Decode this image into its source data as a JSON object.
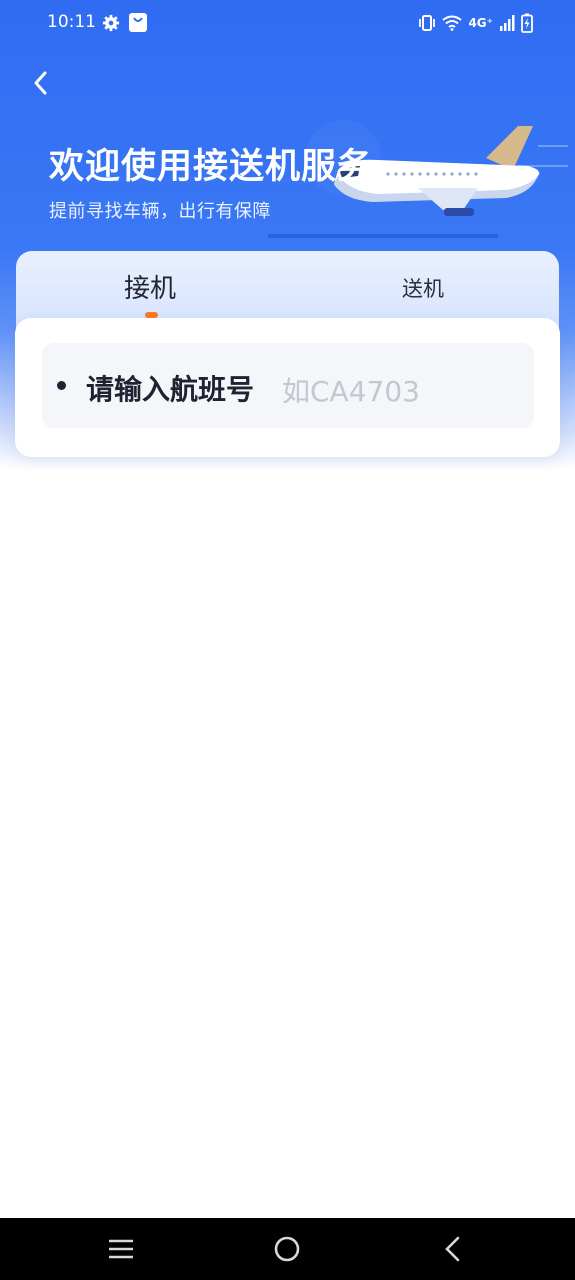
{
  "status_bar": {
    "time": "10:11",
    "network": "4G⁺",
    "icons": [
      "gear-icon",
      "shopping-bag-icon",
      "vibrate-icon",
      "wifi-icon",
      "signal-icon",
      "battery-charging-icon"
    ]
  },
  "header": {
    "back_icon": "chevron-left-icon",
    "title": "欢迎使用接送机服务",
    "subtitle": "提前寻找车辆，出行有保障",
    "illustration": "airplane-illustration"
  },
  "tabs": [
    {
      "label": "接机",
      "active": true
    },
    {
      "label": "送机",
      "active": false
    }
  ],
  "flight_input": {
    "label": "请输入航班号",
    "placeholder": "如CA4703"
  },
  "nav_bar": {
    "icons": [
      "menu-icon",
      "home-circle-icon",
      "back-triangle-icon"
    ]
  },
  "colors": {
    "primary_blue": "#2f6cf2",
    "tab_indicator": "#ff7a1a"
  }
}
